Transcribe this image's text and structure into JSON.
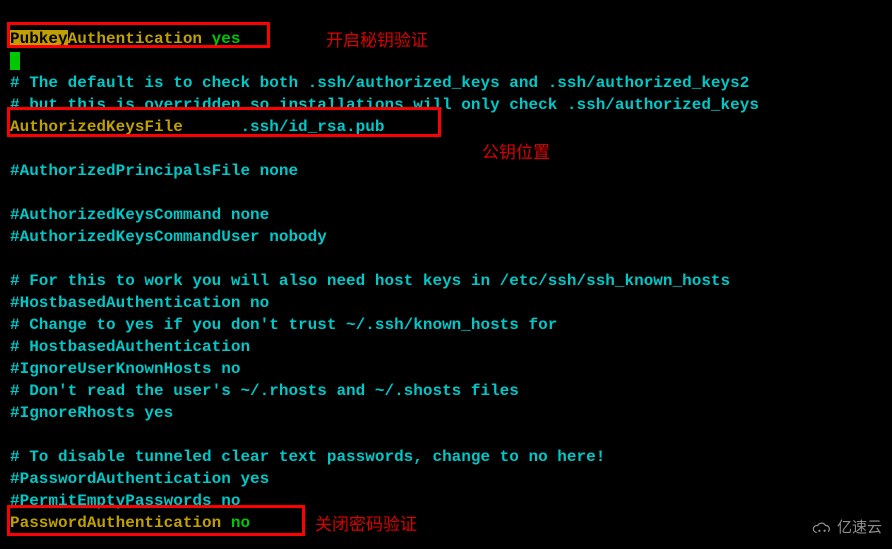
{
  "lines": {
    "l1a": "Pubkey",
    "l1b": "Authentication",
    "l1c": " yes",
    "cursor": " ",
    "l3": "# The default is to check both .ssh/authorized_keys and .ssh/authorized_keys2",
    "l4": "# but this is overridden so installations will only check .ssh/authorized_keys",
    "l5a": "AuthorizedKeysFile",
    "l5b": "      .ssh/id_rsa.pub",
    "l7a": "#AuthorizedPrincipalsFile",
    "l7b": " none",
    "l9a": "#AuthorizedKeysCommand",
    "l9b": " none",
    "l10a": "#AuthorizedKeysCommandUser",
    "l10b": " nobody",
    "l12": "# For this to work you will also need host keys in /etc/ssh/ssh_known_hosts",
    "l13a": "#HostbasedAuthentication",
    "l13b": " no",
    "l14": "# Change to yes if you don't trust ~/.ssh/known_hosts for",
    "l15": "# HostbasedAuthentication",
    "l16a": "#IgnoreUserKnownHosts",
    "l16b": " no",
    "l17": "# Don't read the user's ~/.rhosts and ~/.shosts files",
    "l18a": "#IgnoreRhosts",
    "l18b": " yes",
    "l20": "# To disable tunneled clear text passwords, change to no here!",
    "l21a": "#PasswordAuthentication",
    "l21b": " yes",
    "l22a": "#PermitEmptyPasswords",
    "l22b": " no",
    "l23a": "PasswordAuthentication",
    "l23b": " no"
  },
  "annotations": {
    "a1": "开启秘钥验证",
    "a2": "公钥位置",
    "a3": "关闭密码验证"
  },
  "watermark": "亿速云"
}
